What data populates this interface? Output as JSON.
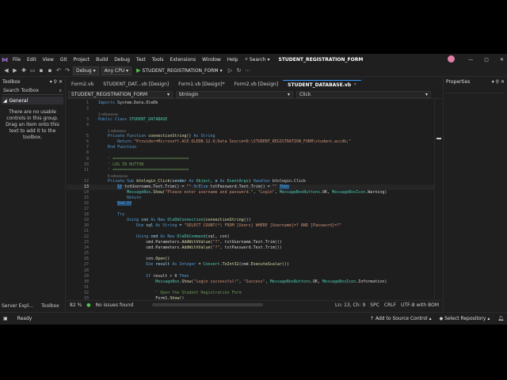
{
  "menu": {
    "items": [
      "File",
      "Edit",
      "View",
      "Git",
      "Project",
      "Build",
      "Debug",
      "Test",
      "Tools",
      "Extensions",
      "Window",
      "Help"
    ],
    "search_label": "Search",
    "solution_title": "STUDENT_REGISTRATION_FORM"
  },
  "toolbar": {
    "config": "Debug",
    "platform": "Any CPU",
    "run_label": "STUDENT_REGISTRATION_FORM"
  },
  "toolbox": {
    "title": "Toolbox",
    "search_placeholder": "Search Toolbox",
    "group": "General",
    "empty_message": "There are no usable controls in this group. Drag an item onto this text to add it to the toolbox."
  },
  "left_tabs": [
    "Server Expl...",
    "Toolbox"
  ],
  "doc_tabs": [
    {
      "label": "Form2.vb",
      "active": false
    },
    {
      "label": "STUDENT_DAT...vb [Design]",
      "active": false
    },
    {
      "label": "Form1.vb [Design]*",
      "active": false
    },
    {
      "label": "Form2.vb [Design]",
      "active": false
    },
    {
      "label": "STUDENT_DATABASE.vb",
      "active": true
    }
  ],
  "navbar": {
    "class_combo": "STUDENT_REGISTRATION_FORM",
    "object_combo": "btnlogin",
    "event_combo": "Click"
  },
  "code_lines": [
    {
      "n": "1",
      "html": "<span class='kw'>Imports</span> System.Data.OleDb"
    },
    {
      "n": "2",
      "html": ""
    },
    {
      "n": "",
      "html": "<span class='ref'>3 references</span>"
    },
    {
      "n": "3",
      "html": "<span class='kw'>Public Class</span> <span class='ty'>STUDENT_DATABASE</span>"
    },
    {
      "n": "4",
      "html": ""
    },
    {
      "n": "",
      "html": "    <span class='ref'>1 reference</span>"
    },
    {
      "n": "5",
      "html": "    <span class='kw'>Private Function</span> <span class='fn'>connectionString</span>() <span class='kw'>As String</span>"
    },
    {
      "n": "6",
      "html": "        <span class='kw'>Return</span> <span class='str'>\"Provider=Microsoft.ACE.OLEDB.12.0;Data Source=D:\\STUDENT_REGISTRATION_FORM\\student.accdb;\"</span>"
    },
    {
      "n": "7",
      "html": "    <span class='kw'>End Function</span>"
    },
    {
      "n": "8",
      "html": ""
    },
    {
      "n": "9",
      "html": "    <span class='cm'>' ================================</span>"
    },
    {
      "n": "10",
      "html": "    <span class='cm'>' LOG IN BUTTON</span>"
    },
    {
      "n": "11",
      "html": "    <span class='cm'>' ================================</span>"
    },
    {
      "n": "",
      "html": "    <span class='ref'>0 references</span>"
    },
    {
      "n": "12",
      "html": "    <span class='kw'>Private Sub</span> <span class='fn'>btnlogin_Click</span>(<span class='id'>sender</span> <span class='kw'>As</span> <span class='ty'>Object</span>, <span class='id'>e</span> <span class='kw'>As</span> <span class='ty'>EventArgs</span>) <span class='kw'>Handles</span> btnlogin.Click"
    },
    {
      "n": "13",
      "html": "        <span class='kw sel'>If</span> txtUsername.Text.Trim() = <span class='str'>\"\"</span> <span class='kw'>OrElse</span> txtPassword.Text.Trim() = <span class='str'>\"\"</span> <span class='kw sel'>Then</span>"
    },
    {
      "n": "14",
      "html": "            <span class='ty'>MessageBox</span>.<span class='fn'>Show</span>(<span class='str'>\"Please enter username and password.\"</span>, <span class='str'>\"Login\"</span>, <span class='ty'>MessageBoxButtons</span>.OK, <span class='ty'>MessageBoxIcon</span>.Warning)"
    },
    {
      "n": "15",
      "html": "            <span class='kw'>Return</span>"
    },
    {
      "n": "16",
      "html": "        <span class='kw sel'>End If</span>"
    },
    {
      "n": "17",
      "html": ""
    },
    {
      "n": "18",
      "html": "        <span class='kw'>Try</span>"
    },
    {
      "n": "19",
      "html": "            <span class='kw'>Using</span> <span class='id'>con</span> <span class='kw'>As New</span> <span class='ty'>OleDbConnection</span>(<span class='fn'>connectionString</span>())"
    },
    {
      "n": "20",
      "html": "                <span class='kw'>Dim</span> <span class='id'>sql</span> <span class='kw'>As String</span> = <span class='str'>\"SELECT COUNT(*) FROM [Users] WHERE [Username]=? AND [Password]=?\"</span>"
    },
    {
      "n": "21",
      "html": ""
    },
    {
      "n": "22",
      "html": "                <span class='kw'>Using</span> <span class='id'>cmd</span> <span class='kw'>As New</span> <span class='ty'>OleDbCommand</span>(sql, con)"
    },
    {
      "n": "23",
      "html": "                    cmd.Parameters.<span class='fn'>AddWithValue</span>(<span class='str'>\"?\"</span>, txtUsername.Text.Trim())"
    },
    {
      "n": "24",
      "html": "                    cmd.Parameters.<span class='fn'>AddWithValue</span>(<span class='str'>\"?\"</span>, txtPassword.Text.Trim())"
    },
    {
      "n": "25",
      "html": ""
    },
    {
      "n": "26",
      "html": "                    con.<span class='fn'>Open</span>()"
    },
    {
      "n": "27",
      "html": "                    <span class='kw'>Dim</span> <span class='id'>result</span> <span class='kw'>As Integer</span> = <span class='ty'>Convert</span>.<span class='fn'>ToInt32</span>(cmd.<span class='fn'>ExecuteScalar</span>())"
    },
    {
      "n": "28",
      "html": ""
    },
    {
      "n": "29",
      "html": "                    <span class='kw'>If</span> result > 0 <span class='kw'>Then</span>"
    },
    {
      "n": "30",
      "html": "                        <span class='ty'>MessageBox</span>.<span class='fn'>Show</span>(<span class='str'>\"Login successful!\"</span>, <span class='str'>\"Success\"</span>, <span class='ty'>MessageBoxButtons</span>.OK, <span class='ty'>MessageBoxIcon</span>.Information)"
    },
    {
      "n": "31",
      "html": ""
    },
    {
      "n": "32",
      "html": "                        <span class='cm'>' Open the Student Registration Form</span>"
    },
    {
      "n": "33",
      "html": "                        Form1.<span class='fn'>Show</span>()"
    }
  ],
  "current_line": "13",
  "editor_status": {
    "zoom": "82 %",
    "issues": "No issues found",
    "position": "Ln: 13, Ch: 9",
    "spc": "SPC",
    "eol": "CRLF",
    "encoding": "UTF-8 with BOM"
  },
  "properties": {
    "title": "Properties"
  },
  "statusbar": {
    "ready": "Ready",
    "source_control": "Add to Source Control",
    "repository": "Select Repository"
  }
}
